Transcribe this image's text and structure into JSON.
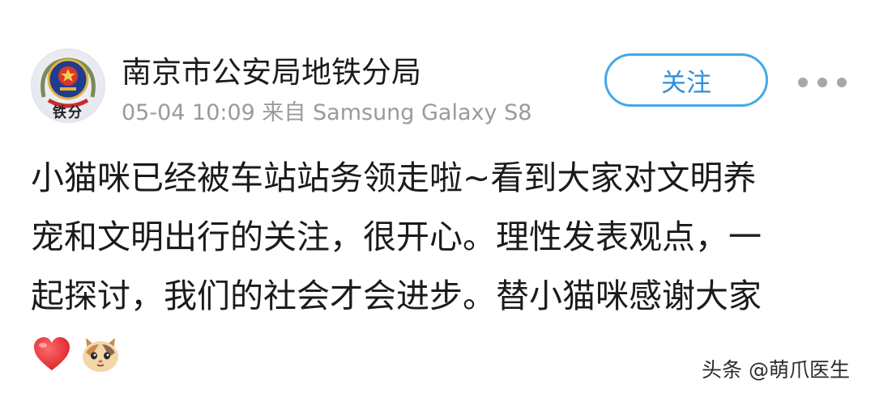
{
  "header": {
    "account_name": "南京市公安局地铁分局",
    "avatar_caption": "铁分",
    "meta": "05-04 10:09 来自 Samsung Galaxy S8",
    "follow_label": "关注"
  },
  "post": {
    "lines": [
      "小猫咪已经被车站站务领走啦~看到大家对文明养",
      "宠和文明出行的关注，很开心。理性发表观点，一",
      "起探讨，我们的社会才会进步。替小猫咪感谢大家"
    ],
    "emojis": [
      "heart-emoji",
      "cat-face-emoji"
    ]
  },
  "watermark": "头条 @萌爪医生",
  "colors": {
    "accent": "#43a8e8",
    "meta_gray": "#9a9a9a",
    "heart": "#e8363c",
    "badge_blue": "#1f3d8f",
    "badge_gold": "#e3b23c"
  }
}
